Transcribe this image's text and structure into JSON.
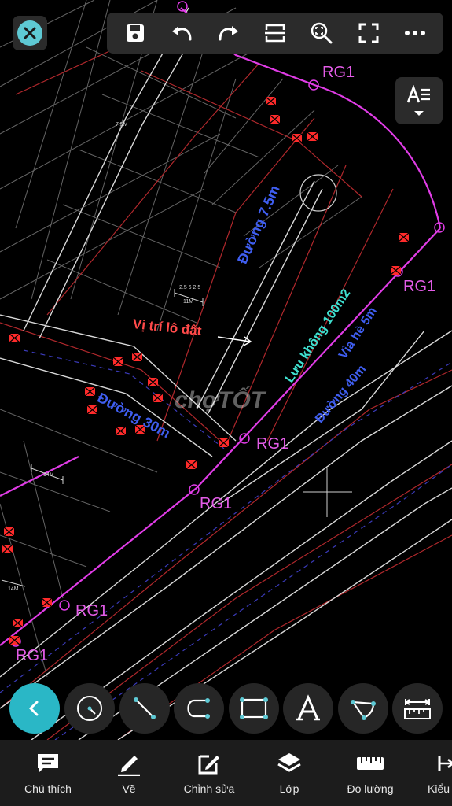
{
  "map": {
    "labels": {
      "rg1_top_right": "RG1",
      "rg1_right": "RG1",
      "rg1_center": "RG1",
      "rg1_mid": "RG1",
      "rg1_bottom_mid": "RG1",
      "rg1_bottom_left": "RG1",
      "road_7_5": "Đường 7.5m",
      "setback": "Lưu không 100m2",
      "sidewalk": "Vỉa hè 5m",
      "road_40": "Đường 40m",
      "road_30": "Đường 30m",
      "plot_location": "Vị trí lô đất",
      "watermark": "chợTỐT",
      "dim_11m": "11M",
      "dim_2_5": "2.5   6   2.5",
      "dim_14m_a": "14M",
      "dim_14m_b": "14M",
      "dim_7_5m": "7.5M"
    },
    "colors": {
      "boundary": "#e03ce6",
      "road_text": "#3f5ef0",
      "setback_text": "#3fe0d0",
      "plot_text": "#ff4a4a",
      "markers": "#ff2b2b",
      "lines": "#c8c8c8"
    }
  },
  "toolbar": {
    "close": "close-icon",
    "icons": [
      "save-icon",
      "undo-icon",
      "redo-icon",
      "scan-area-icon",
      "zoom-fit-icon",
      "fullscreen-icon",
      "more-icon"
    ],
    "text_style": "text-style-icon"
  },
  "tools": [
    "back-icon",
    "circle-tool-icon",
    "line-tool-icon",
    "polyline-tool-icon",
    "rectangle-tool-icon",
    "text-tool-icon",
    "arc-tool-icon",
    "measure-tool-icon"
  ],
  "bottom_nav": {
    "annotate": "Chú thích",
    "draw": "Vẽ",
    "edit": "Chỉnh sửa",
    "layers": "Lớp",
    "measure": "Đo lường",
    "style": "Kiểu"
  },
  "accent": "#2ab7c6"
}
